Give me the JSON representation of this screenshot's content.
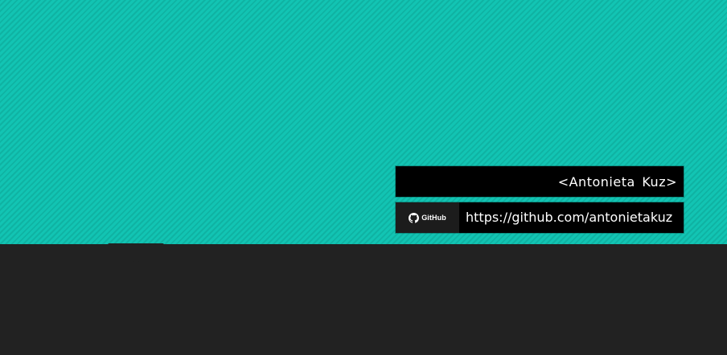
{
  "profile": {
    "name": "<Antonieta  Kuz>",
    "github_label": "GitHub",
    "github_url": "https://github.com/antonietakuz"
  },
  "icons": {
    "github": "github-octocat-icon"
  },
  "colors": {
    "hero_teal": "#12c4b3",
    "hero_stripe": "#0fb3a3",
    "dark_panel": "#222222",
    "card_background": "#000000",
    "badge_background": "#1c1c1c",
    "text": "#ffffff"
  }
}
